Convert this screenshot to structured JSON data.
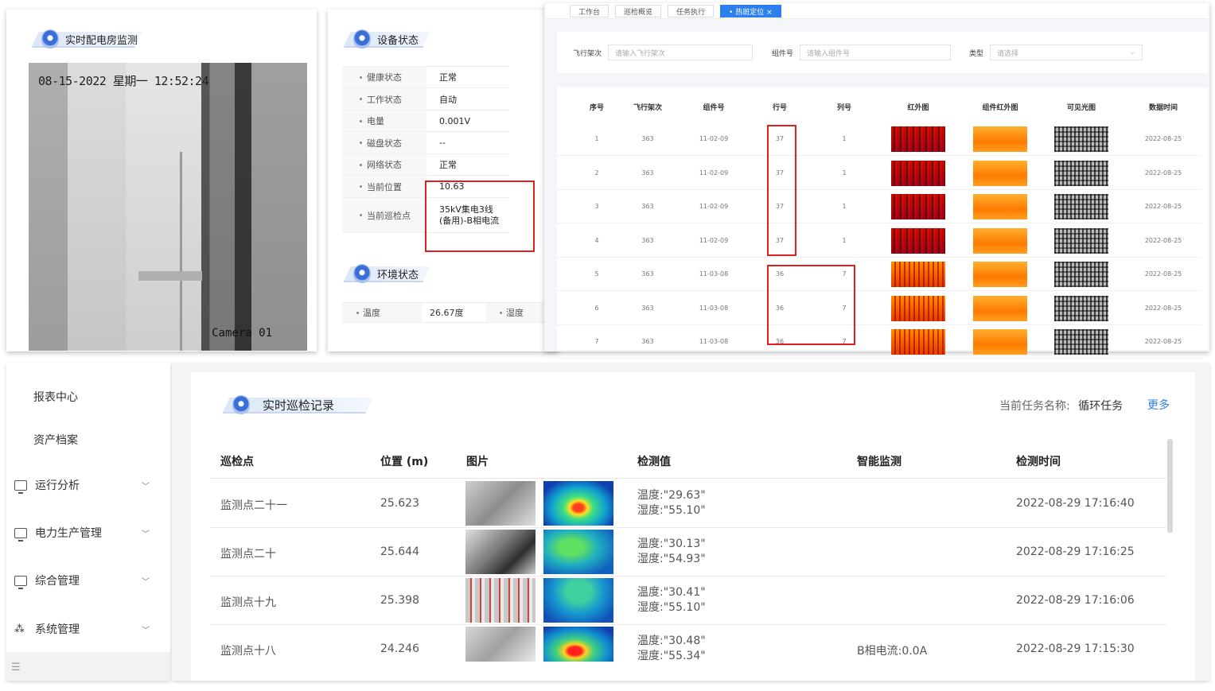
{
  "camera_panel": {
    "title": "实时配电房监测",
    "timestamp": "08-15-2022 星期一 12:52:24",
    "camera_label": "Camera 01"
  },
  "device_status": {
    "title": "设备状态",
    "rows": [
      {
        "key": "健康状态",
        "value": "正常"
      },
      {
        "key": "工作状态",
        "value": "自动"
      },
      {
        "key": "电量",
        "value": "0.001V"
      },
      {
        "key": "磁盘状态",
        "value": "--"
      },
      {
        "key": "网络状态",
        "value": "正常"
      },
      {
        "key": "当前位置",
        "value": "10.63"
      },
      {
        "key": "当前巡检点",
        "value": "35kV集电3线(备用)-B相电流"
      }
    ]
  },
  "env_status": {
    "title": "环境状态",
    "temp_label": "温度",
    "temp_value": "26.67度",
    "humidity_label": "湿度"
  },
  "flight_panel": {
    "tabs": [
      "工作台",
      "巡检概览",
      "任务执行",
      "• 热斑定位 ×"
    ],
    "filters": {
      "flight_label": "飞行架次",
      "flight_placeholder": "请输入飞行架次",
      "component_label": "组件号",
      "component_placeholder": "请输入组件号",
      "type_label": "类型",
      "type_placeholder": "请选择"
    },
    "columns": [
      "序号",
      "飞行架次",
      "组件号",
      "行号",
      "列号",
      "红外图",
      "组件红外图",
      "可见光图",
      "数据时间"
    ],
    "rows": [
      {
        "no": "1",
        "flight": "363",
        "component": "11-02-09",
        "row": "37",
        "col": "1",
        "date": "2022-08-25"
      },
      {
        "no": "2",
        "flight": "363",
        "component": "11-02-09",
        "row": "37",
        "col": "1",
        "date": "2022-08-25"
      },
      {
        "no": "3",
        "flight": "363",
        "component": "11-02-09",
        "row": "37",
        "col": "1",
        "date": "2022-08-25"
      },
      {
        "no": "4",
        "flight": "363",
        "component": "11-02-09",
        "row": "37",
        "col": "1",
        "date": "2022-08-25"
      },
      {
        "no": "5",
        "flight": "363",
        "component": "11-03-08",
        "row": "36",
        "col": "7",
        "date": "2022-08-25"
      },
      {
        "no": "6",
        "flight": "363",
        "component": "11-03-08",
        "row": "36",
        "col": "7",
        "date": "2022-08-25"
      },
      {
        "no": "7",
        "flight": "363",
        "component": "11-03-08",
        "row": "36",
        "col": "7",
        "date": "2022-08-25"
      }
    ]
  },
  "sidebar": {
    "items": [
      {
        "label": "报表中心"
      },
      {
        "label": "资产档案"
      },
      {
        "label": "运行分析"
      },
      {
        "label": "电力生产管理"
      },
      {
        "label": "综合管理"
      },
      {
        "label": "系统管理"
      }
    ]
  },
  "records": {
    "title": "实时巡检记录",
    "task_label": "当前任务名称:",
    "task_name": "循环任务",
    "more": "更多",
    "columns": [
      "巡检点",
      "位置 (m)",
      "图片",
      "检测值",
      "智能监测",
      "检测时间"
    ],
    "rows": [
      {
        "point": "监测点二十一",
        "position": "25.623",
        "temp": "温度:\"29.63\"",
        "humidity": "湿度:\"55.10\"",
        "smart": "",
        "time": "2022-08-29 17:16:40"
      },
      {
        "point": "监测点二十",
        "position": "25.644",
        "temp": "温度:\"30.13\"",
        "humidity": "湿度:\"54.93\"",
        "smart": "",
        "time": "2022-08-29 17:16:25"
      },
      {
        "point": "监测点十九",
        "position": "25.398",
        "temp": "温度:\"30.41\"",
        "humidity": "湿度:\"55.10\"",
        "smart": "",
        "time": "2022-08-29 17:16:06"
      },
      {
        "point": "监测点十八",
        "position": "24.246",
        "temp": "温度:\"30.48\"",
        "humidity": "湿度:\"55.34\"",
        "smart": "B相电流:0.0A",
        "time": "2022-08-29 17:15:30"
      }
    ]
  }
}
